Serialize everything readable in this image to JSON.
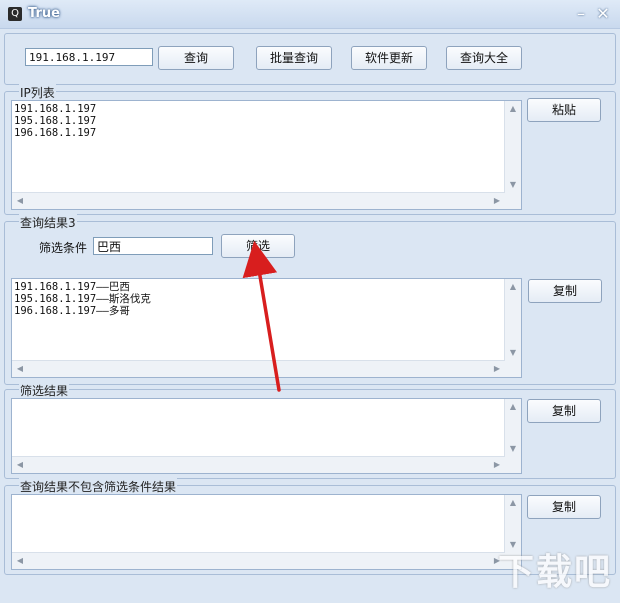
{
  "window": {
    "title": "True",
    "app_icon": "Q"
  },
  "top": {
    "ip_value": "191.168.1.197",
    "buttons": [
      "查询",
      "批量查询",
      "软件更新",
      "查询大全"
    ]
  },
  "ip_list": {
    "title": "IP列表",
    "lines": [
      "191.168.1.197",
      "195.168.1.197",
      "196.168.1.197"
    ],
    "paste_label": "粘贴"
  },
  "query_result": {
    "title": "查询结果3",
    "filter_label": "筛选条件",
    "filter_value": "巴西",
    "filter_button": "筛选",
    "lines": [
      "191.168.1.197——巴西",
      "195.168.1.197——斯洛伐克",
      "196.168.1.197——多哥"
    ],
    "copy_label": "复制"
  },
  "filter_result": {
    "title": "筛选结果",
    "copy_label": "复制"
  },
  "excluded_result": {
    "title": "查询结果不包含筛选条件结果",
    "copy_label": "复制"
  },
  "watermark": "下载吧",
  "accent_color": "#d81e1e"
}
